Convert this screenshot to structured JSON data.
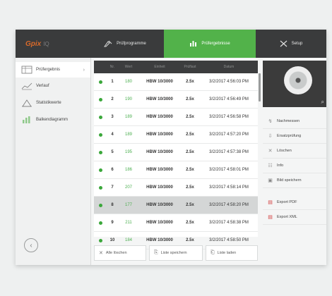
{
  "app": {
    "logo": "Gpix",
    "logo_suffix": "IQ"
  },
  "topnav": [
    {
      "label": "Prüfprogramme",
      "icon": "pen-tools-icon"
    },
    {
      "label": "Prüfergebnisse",
      "icon": "results-grid-icon"
    },
    {
      "label": "Setup",
      "icon": "wrench-icon"
    }
  ],
  "sidebar": {
    "items": [
      {
        "label": "Prüfergebnis",
        "icon": "table-icon"
      },
      {
        "label": "Verlauf",
        "icon": "line-chart-icon"
      },
      {
        "label": "Statistikwerte",
        "icon": "triangle-icon"
      },
      {
        "label": "Balkendiagramm",
        "icon": "bar-chart-icon"
      }
    ],
    "chevron": "›",
    "back": "‹"
  },
  "table": {
    "headers": [
      "",
      "Nr.",
      "Wert",
      "Einheit",
      "Prüflast",
      "Datum"
    ],
    "rows": [
      {
        "no": "1",
        "val": "180",
        "method": "HBW 10/3000",
        "load": "2.5x",
        "date": "3/2/2017 4:56:03 PM"
      },
      {
        "no": "2",
        "val": "190",
        "method": "HBW 10/3000",
        "load": "2.5x",
        "date": "3/2/2017 4:56:49 PM"
      },
      {
        "no": "3",
        "val": "189",
        "method": "HBW 10/3000",
        "load": "2.5x",
        "date": "3/2/2017 4:56:58 PM"
      },
      {
        "no": "4",
        "val": "189",
        "method": "HBW 10/3000",
        "load": "2.5x",
        "date": "3/2/2017 4:57:20 PM"
      },
      {
        "no": "5",
        "val": "195",
        "method": "HBW 10/3000",
        "load": "2.5x",
        "date": "3/2/2017 4:57:38 PM"
      },
      {
        "no": "6",
        "val": "186",
        "method": "HBW 10/3000",
        "load": "2.5x",
        "date": "3/2/2017 4:58:01 PM"
      },
      {
        "no": "7",
        "val": "207",
        "method": "HBW 10/3000",
        "load": "2.5x",
        "date": "3/2/2017 4:58:14 PM"
      },
      {
        "no": "8",
        "val": "177",
        "method": "HBW 10/3000",
        "load": "2.5x",
        "date": "3/2/2017 4:58:20 PM"
      },
      {
        "no": "9",
        "val": "211",
        "method": "HBW 10/3000",
        "load": "2.5x",
        "date": "3/2/2017 4:58:38 PM"
      },
      {
        "no": "10",
        "val": "184",
        "method": "HBW 10/3000",
        "load": "2.5x",
        "date": "3/2/2017 4:58:50 PM"
      }
    ],
    "selected_row": "8"
  },
  "bottom": {
    "delete_all": "Alle löschen",
    "save_list": "Liste speichern",
    "load_list": "Liste laden"
  },
  "right": {
    "buttons": [
      {
        "label": "Nachmessen",
        "icon": "remeasure-icon"
      },
      {
        "label": "Ersatzprüfung",
        "icon": "replace-icon"
      },
      {
        "label": "Löschen",
        "icon": "close-icon"
      },
      {
        "label": "Info",
        "icon": "info-icon"
      },
      {
        "label": "Bild speichern",
        "icon": "save-image-icon"
      }
    ],
    "export": [
      {
        "label": "Export PDF",
        "icon": "pdf-icon"
      },
      {
        "label": "Export XML",
        "icon": "xml-icon"
      }
    ]
  },
  "colors": {
    "accent": "#52b24a",
    "topbar": "#3a3b3c",
    "status": "#3aa73a",
    "export": "#d23a3a"
  }
}
